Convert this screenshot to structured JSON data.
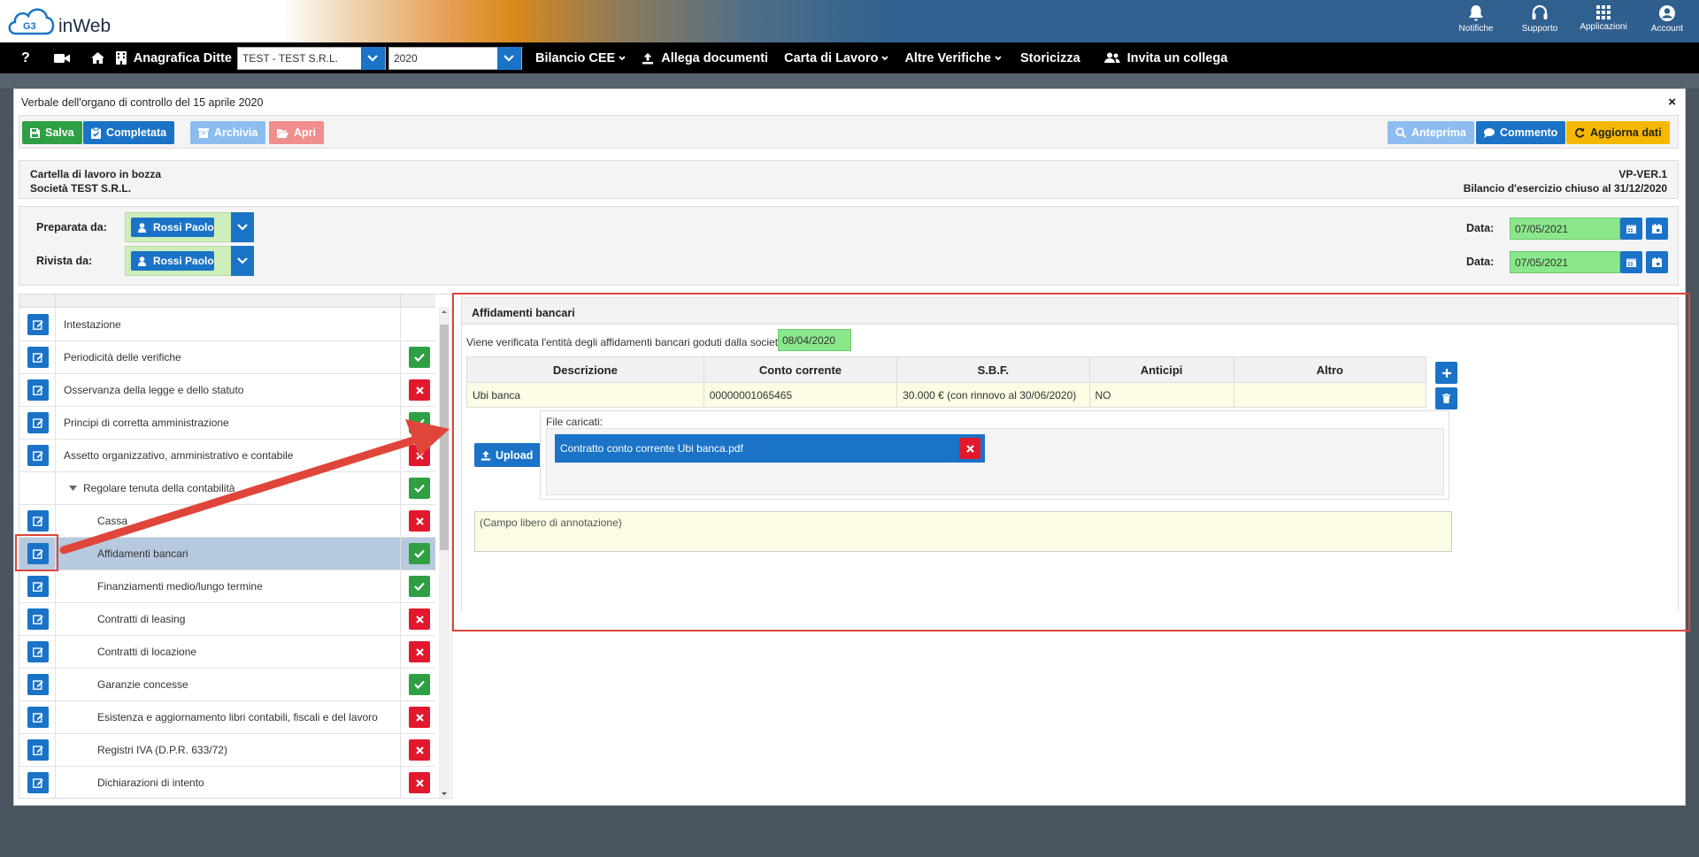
{
  "app": {
    "logo_text": "inWeb",
    "logo_mark": "G3"
  },
  "topbar_icons": [
    {
      "icon": "bell-icon",
      "label": "Notifiche"
    },
    {
      "icon": "headset-icon",
      "label": "Supporto"
    },
    {
      "icon": "grid-icon",
      "label": "Applicazioni"
    },
    {
      "icon": "user-circle-icon",
      "label": "Account"
    }
  ],
  "nav": {
    "help": "?",
    "ditte_label": "Anagrafica Ditte",
    "company_select": "TEST - TEST S.R.L.",
    "year_select": "2020",
    "items": [
      "Bilancio CEE",
      "Allega documenti",
      "Carta di Lavoro",
      "Altre Verifiche",
      "Storicizza",
      "Invita un collega"
    ]
  },
  "window": {
    "title": "Verbale dell'organo di controllo del 15 aprile 2020",
    "close": "×"
  },
  "toolbar": {
    "salva": "Salva",
    "completata": "Completata",
    "archivia": "Archivia",
    "apri": "Apri",
    "anteprima": "Anteprima",
    "commento": "Commento",
    "aggiorna": "Aggiorna dati"
  },
  "info": {
    "status": "Cartella di lavoro in bozza",
    "company": "Società TEST S.R.L.",
    "code": "VP-VER.1",
    "period": "Bilancio d'esercizio chiuso al 31/12/2020"
  },
  "people": {
    "prepared_label": "Preparata da:",
    "prepared_name": "Rossi Paolo",
    "reviewed_label": "Rivista da:",
    "reviewed_name": "Rossi Paolo",
    "date_label": "Data:",
    "prepared_date": "07/05/2021",
    "reviewed_date": "07/05/2021"
  },
  "tree": [
    {
      "label": "Intestazione",
      "level": 0,
      "editable": true,
      "status": "none"
    },
    {
      "label": "Periodicità delle verifiche",
      "level": 0,
      "editable": true,
      "status": "ok"
    },
    {
      "label": "Osservanza della legge e dello statuto",
      "level": 0,
      "editable": true,
      "status": "ko"
    },
    {
      "label": "Principi di corretta amministrazione",
      "level": 0,
      "editable": true,
      "status": "ok"
    },
    {
      "label": "Assetto organizzativo, amministrativo e contabile",
      "level": 0,
      "editable": true,
      "status": "ko"
    },
    {
      "label": "Regolare tenuta della contabilità",
      "level": 1,
      "editable": false,
      "status": "ok"
    },
    {
      "label": "Cassa",
      "level": 2,
      "editable": true,
      "status": "ko"
    },
    {
      "label": "Affidamenti bancari",
      "level": 2,
      "editable": true,
      "status": "ok",
      "selected": true
    },
    {
      "label": "Finanziamenti medio/lungo termine",
      "level": 2,
      "editable": true,
      "status": "ok"
    },
    {
      "label": "Contratti di leasing",
      "level": 2,
      "editable": true,
      "status": "ko"
    },
    {
      "label": "Contratti di locazione",
      "level": 2,
      "editable": true,
      "status": "ko"
    },
    {
      "label": "Garanzie concesse",
      "level": 2,
      "editable": true,
      "status": "ok"
    },
    {
      "label": "Esistenza e aggiornamento libri contabili, fiscali e del lavoro",
      "level": 2,
      "editable": true,
      "status": "ko"
    },
    {
      "label": "Registri IVA (D.P.R. 633/72)",
      "level": 2,
      "editable": true,
      "status": "ko"
    },
    {
      "label": "Dichiarazioni di intento",
      "level": 2,
      "editable": true,
      "status": "ko"
    }
  ],
  "detail": {
    "title": "Affidamenti bancari",
    "verif_text": "Viene verificata l'entità degli affidamenti bancari goduti dalla società alla data del",
    "verif_date": "08/04/2020",
    "columns": [
      "Descrizione",
      "Conto corrente",
      "S.B.F.",
      "Anticipi",
      "Altro"
    ],
    "rows": [
      [
        "Ubi banca",
        "00000001065465",
        "30.000 € (con rinnovo al 30/06/2020)",
        "NO",
        ""
      ]
    ],
    "upload": "Upload",
    "files_label": "File caricati:",
    "files": [
      "Contratto conto corrente Ubi banca.pdf"
    ],
    "note_placeholder": "(Campo libero di annotazione)"
  },
  "colors": {
    "primary": "#1a73c7",
    "success": "#2ea043",
    "danger": "#e3182d",
    "warning": "#f5b800",
    "highlight": "#e0453a"
  }
}
